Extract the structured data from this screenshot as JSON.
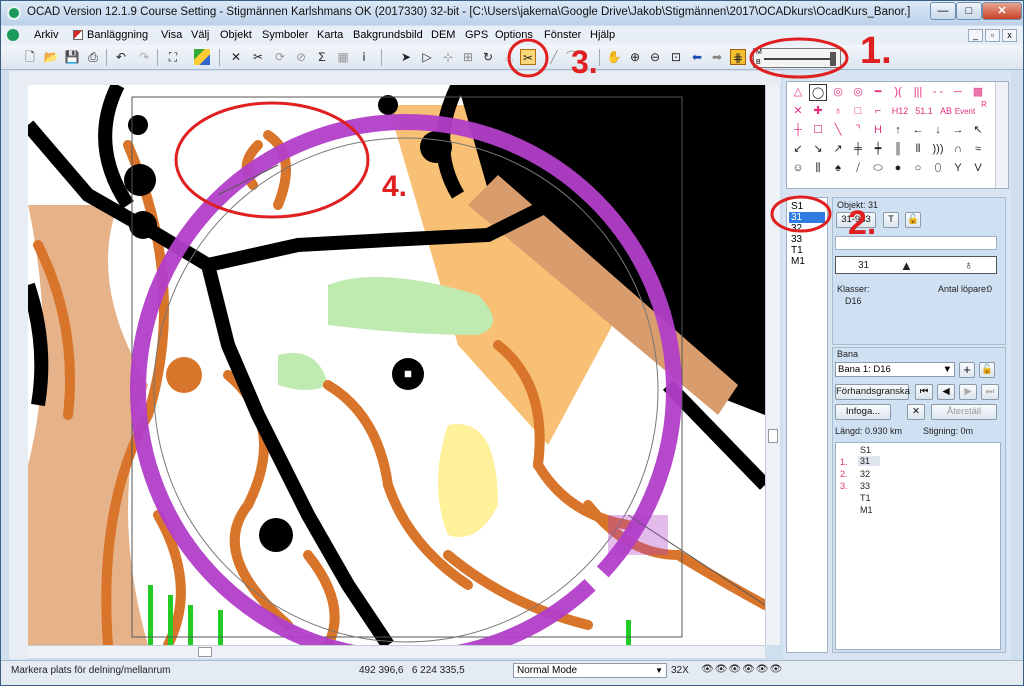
{
  "window": {
    "title": "OCAD Version 12.1.9  Course Setting - Stigmännen Karlshmans OK (2017330) 32-bit - [C:\\Users\\jakema\\Google Drive\\Jakob\\Stigmännen\\2017\\OCADkurs\\OcadKurs_Banor.]",
    "minimize": "—",
    "maximize": "□",
    "close": "✕"
  },
  "menu": [
    "Arkiv",
    "Banläggning",
    "Visa",
    "Välj",
    "Objekt",
    "Symboler",
    "Karta",
    "Bakgrundsbild",
    "DEM",
    "GPS",
    "Options",
    "Fönster",
    "Hjälp"
  ],
  "annotations": [
    "1.",
    "2.",
    "3.",
    "4."
  ],
  "zoom_slider": {
    "top_label": "M",
    "bottom_label": "B"
  },
  "symbols": {
    "texts": [
      "H12",
      "51.1",
      "AB",
      "Event",
      "R"
    ]
  },
  "course_list": [
    "S1",
    "31",
    "32",
    "33",
    "T1",
    "M1"
  ],
  "selected_course_item": "31",
  "object_panel": {
    "title": "Objekt: 31",
    "code_button": "31-933",
    "text_button": "T",
    "lock_button": "🔓",
    "number": "31",
    "klasser_label": "Klasser:",
    "antal_label": "Antal löpare:",
    "antal_value": "0",
    "klass_value": "D16"
  },
  "bana_panel": {
    "title": "Bana",
    "course_select": "Bana 1: D16",
    "preview_button": "Förhandsgranska",
    "insert_button": "Infoga...",
    "delete_button": "✕",
    "restore_button": "Återställ",
    "length": "Längd: 0.930 km",
    "climb": "Stigning: 0m",
    "items": [
      {
        "num": "",
        "code": "S1"
      },
      {
        "num": "1.",
        "code": "31"
      },
      {
        "num": "2.",
        "code": "32"
      },
      {
        "num": "3.",
        "code": "33"
      },
      {
        "num": "",
        "code": "T1"
      },
      {
        "num": "",
        "code": "M1"
      }
    ]
  },
  "status": {
    "message": "Markera plats för delning/mellanrum",
    "coords": "492 396,6   6 224 335,5",
    "mode": "Normal Mode",
    "zoom": "32X"
  },
  "colors": {
    "accent": "#b23ec9",
    "annotation": "#e02020"
  }
}
